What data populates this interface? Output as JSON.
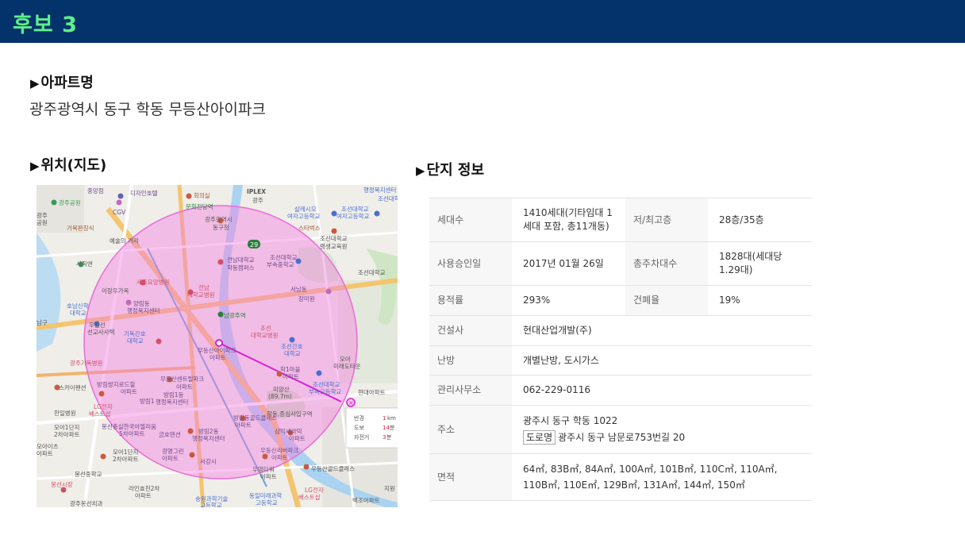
{
  "header": {
    "title": "후보 3"
  },
  "sections": {
    "apartment_heading": "아파트명",
    "location_heading": "위치(지도)",
    "complex_heading": "단지 정보"
  },
  "apartment": {
    "name": "광주광역시 동구 학동 무등산아이파크"
  },
  "map": {
    "labels": {
      "l1": "중앙점",
      "l2": "디자인호텔",
      "l3": "회의실",
      "l4": "IPLEX",
      "l5": "행정복지센터",
      "l6": "광주공원",
      "l7": "CGV",
      "l8": "문화전당역",
      "l9": "광주",
      "l10": "살레시오",
      "l11": "여자고등학교",
      "l12": "조선대학교",
      "l13": "광주",
      "l14": "광주광역시",
      "l15": "동구청",
      "l16": "스타벅스",
      "l17": "조선대학교",
      "l18": "평생교육원",
      "l19": "거목판칭식",
      "l20": "예술의 거리",
      "l21": "전남대학교",
      "l22": "학동캠퍼스",
      "l23": "조선대학교",
      "l24": "부속중학교",
      "l25": "사직앤",
      "l26": "조선대학교",
      "l27": "서남동",
      "l28": "장미원",
      "l29": "세종요양병원",
      "l30": "전남",
      "l31": "대학교병원",
      "l32": "양림동",
      "l33": "행정복지센터",
      "l34": "이장우가옥",
      "l35": "남광주역",
      "l36": "호남신학",
      "l37": "대학교",
      "l38": "우일선",
      "l39": "선교사사택",
      "l40": "기독간호",
      "l41": "대학교",
      "l42": "조선",
      "l43": "대학교병원",
      "l44": "조선간호",
      "l45": "대학교",
      "l46": "무등산아이파크",
      "l47": "아파트",
      "l48": "광주기독병원",
      "l49": "학1마을",
      "l50": "아파트",
      "l51": "모아",
      "l52": "미래도타운",
      "l53": "스카이팬션",
      "l54": "방림쌍지로드힐",
      "l55": "아파트",
      "l56": "무등산센트럴파크",
      "l57": "아파트",
      "l58": "방림1동",
      "l59": "행정복지센터",
      "l60": "방림1",
      "l61": "미양산",
      "l62": "(89.7m)",
      "l63": "조선대학교",
      "l64": "부속고등학교",
      "l65": "현대아파트",
      "l66": "한일병원",
      "l67": "학동,증심사입구역",
      "l68": "방림동골드클래스",
      "l69": "아파트",
      "l70": "모아1단지",
      "l71": "2차아파트",
      "l72": "봉선충실한국아델리움",
      "l73": "5차아파트",
      "l74": "금호맨션",
      "l75": "방림2동",
      "l76": "행정복지센터",
      "l77": "삼익세라믹",
      "l78": "아파트",
      "l79": "LG전자",
      "l80": "베스트샵",
      "l81": "모아이츠",
      "l82": "아파트",
      "l83": "모아1단지",
      "l84": "2차아파트",
      "l85": "광명그린",
      "l86": "아파트",
      "l87": "서강시",
      "l88": "우등산리버파크",
      "l89": "아파트",
      "l90": "우영타워",
      "l91": "아파트",
      "l92": "봉선중학교",
      "l93": "라인효천2차",
      "l94": "아파트",
      "l95": "우등산골드클래스",
      "l96": "봉선시장",
      "l97": "송원과학기술",
      "l98": "동일미래과학",
      "l99": "LG전자",
      "l100": "베스트샵",
      "l101": "고등학교",
      "l102": "고등학교",
      "l103": "지원",
      "l104": "광주봉선치과",
      "l105": "백조아파트",
      "l106": "행정",
      "l107": "남구",
      "l108": "여자고등학교",
      "l109": "조선대학교",
      "l110": "공원"
    },
    "popup": {
      "rows": [
        {
          "label": "반경",
          "value": "1",
          "unit": "km"
        },
        {
          "label": "도보",
          "value": "14",
          "unit": "분"
        },
        {
          "label": "자전거",
          "value": "3",
          "unit": "분"
        }
      ]
    },
    "road_badge": "29",
    "colors": {
      "circle": "#f47ee0",
      "line": "#d61fd6",
      "road": "#f4c46e",
      "river": "#a9d3f0"
    }
  },
  "complex": {
    "rows": [
      {
        "l1": "세대수",
        "v1": "1410세대(기타임대 1세대 포함, 총11개동)",
        "l2": "저/최고층",
        "v2": "28층/35층"
      },
      {
        "l1": "사용승인일",
        "v1": "2017년 01월 26일",
        "l2": "총주차대수",
        "v2": "1828대(세대당 1.29대)"
      },
      {
        "l1": "용적률",
        "v1": "293%",
        "l2": "건폐율",
        "v2": "19%"
      }
    ],
    "builder": {
      "label": "건설사",
      "value": "현대산업개발(주)"
    },
    "heating": {
      "label": "난방",
      "value": "개별난방, 도시가스"
    },
    "office": {
      "label": "관리사무소",
      "value": "062-229-0116"
    },
    "address": {
      "label": "주소",
      "jibun": "광주시 동구 학동 1022",
      "road_tag": "도로명",
      "road": "광주시 동구 남문로753번길 20"
    },
    "area": {
      "label": "면적",
      "value": "64㎡, 83B㎡, 84A㎡, 100A㎡, 101B㎡, 110C㎡, 110A㎡, 110B㎡, 110E㎡, 129B㎡, 131A㎡, 144㎡, 150㎡"
    }
  }
}
